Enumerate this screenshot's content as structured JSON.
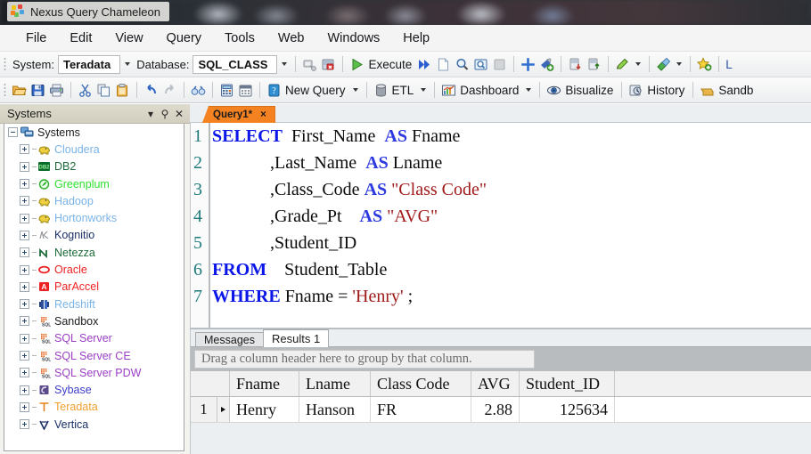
{
  "window": {
    "title": "Nexus Query Chameleon"
  },
  "menu": {
    "items": [
      {
        "label": "File"
      },
      {
        "label": "Edit"
      },
      {
        "label": "View"
      },
      {
        "label": "Query"
      },
      {
        "label": "Tools"
      },
      {
        "label": "Web"
      },
      {
        "label": "Windows"
      },
      {
        "label": "Help"
      }
    ]
  },
  "toolbar_top": {
    "system_label": "System:",
    "system_value": "Teradata",
    "database_label": "Database:",
    "database_value": "SQL_CLASS",
    "execute_label": "Execute",
    "icons": [
      "disconnect-icon",
      "stop-connection-icon",
      "execute-play-icon",
      "execute-all-icon",
      "new-document-icon",
      "find-icon",
      "find-in-window-icon",
      "stop-icon",
      "add-plus-icon",
      "add-object-icon",
      "load-data-icon",
      "export-data-icon",
      "edit-pencil-icon",
      "pencil-dropdown-caret",
      "paint-brush-icon",
      "brush-dropdown-caret",
      "favorite-star-icon",
      "truncated-l-icon"
    ]
  },
  "toolbar_bottom": {
    "new_query_label": "New Query",
    "etl_label": "ETL",
    "dashboard_label": "Dashboard",
    "bisualize_label": "Bisualize",
    "history_label": "History",
    "sandbox_label": "Sandb",
    "icons": [
      "open-folder-icon",
      "save-icon",
      "print-icon",
      "cut-icon",
      "copy-icon",
      "paste-icon",
      "undo-icon",
      "redo-icon",
      "binoculars-icon",
      "calculator-icon",
      "calendar-icon",
      "new-query-icon",
      "new-query-dropdown-caret",
      "etl-icon",
      "etl-dropdown-caret",
      "dashboard-icon",
      "dashboard-dropdown-caret",
      "bisualize-eye-icon",
      "history-icon",
      "sandbox-icon"
    ]
  },
  "sidebar": {
    "title": "Systems",
    "header_icons": [
      "chevron-down-icon",
      "pin-icon",
      "close-icon"
    ],
    "root": {
      "label": "Systems",
      "icon": "systems-root-icon",
      "color": "#1b1b1b"
    },
    "items": [
      {
        "label": "Cloudera",
        "icon": "elephant-icon",
        "color": "#7ab4e8"
      },
      {
        "label": "DB2",
        "icon": "db2-icon",
        "color": "#1d6b3a"
      },
      {
        "label": "Greenplum",
        "icon": "greenplum-icon",
        "color": "#2ee02e"
      },
      {
        "label": "Hadoop",
        "icon": "elephant-icon",
        "color": "#7ab4e8"
      },
      {
        "label": "Hortonworks",
        "icon": "elephant-icon",
        "color": "#7ab4e8"
      },
      {
        "label": "Kognitio",
        "icon": "kognitio-icon",
        "color": "#1b2f66"
      },
      {
        "label": "Netezza",
        "icon": "netezza-icon",
        "color": "#1d6b3a"
      },
      {
        "label": "Oracle",
        "icon": "oracle-icon",
        "color": "#ee2222"
      },
      {
        "label": "ParAccel",
        "icon": "paraccel-icon",
        "color": "#ee2222"
      },
      {
        "label": "Redshift",
        "icon": "redshift-icon",
        "color": "#7ab4e8"
      },
      {
        "label": "Sandbox",
        "icon": "sqlserver-icon",
        "color": "#1b1b1b"
      },
      {
        "label": "SQL Server",
        "icon": "sqlserver-icon",
        "color": "#9b3fc4"
      },
      {
        "label": "SQL Server CE",
        "icon": "sqlserver-icon",
        "color": "#9b3fc4"
      },
      {
        "label": "SQL Server PDW",
        "icon": "sqlserver-icon",
        "color": "#9b3fc4"
      },
      {
        "label": "Sybase",
        "icon": "sybase-icon",
        "color": "#3c3cc8"
      },
      {
        "label": "Teradata",
        "icon": "teradata-icon",
        "color": "#f0a030"
      },
      {
        "label": "Vertica",
        "icon": "vertica-icon",
        "color": "#1b2f66"
      }
    ]
  },
  "editor": {
    "tab": {
      "label": "Query1*",
      "close": "×"
    },
    "lines": [
      {
        "n": "1",
        "indent": 0
      },
      {
        "n": "2",
        "indent": 0
      },
      {
        "n": "3",
        "indent": 0
      },
      {
        "n": "4",
        "indent": 0
      },
      {
        "n": "5",
        "indent": 0
      },
      {
        "n": "6",
        "indent": 0
      },
      {
        "n": "7",
        "indent": 0
      }
    ],
    "code": {
      "l1_kw": "SELECT",
      "l1_col": "  First_Name",
      "l1_as": "AS",
      "l1_alias": " Fname",
      "l2_col": "             ,Last_Name",
      "l2_as": "AS",
      "l2_alias": " Lname",
      "l3_col": "             ,Class_Code",
      "l3_as": "AS",
      "l3_alias": " \"Class Code\"",
      "l4_col": "             ,Grade_Pt",
      "l4_as": "AS",
      "l4_alias": " \"AVG\"",
      "l5_col": "             ,Student_ID",
      "l6_kw": "FROM",
      "l6_rest": "    Student_Table",
      "l7_kw": "WHERE",
      "l7_mid": " Fname = ",
      "l7_str": "'Henry'",
      "l7_end": " ;"
    }
  },
  "results": {
    "tabs": [
      {
        "label": "Messages",
        "active": false
      },
      {
        "label": "Results 1",
        "active": true
      }
    ],
    "group_hint": "Drag a column header here to group by that column.",
    "columns": [
      "Fname",
      "Lname",
      "Class Code",
      "AVG",
      "Student_ID"
    ],
    "rows": [
      {
        "index": "1",
        "Fname": "Henry",
        "Lname": "Hanson",
        "Class Code": "FR",
        "AVG": "2.88",
        "Student_ID": "125634"
      }
    ]
  },
  "colors": {
    "tab_accent": "#f58220",
    "keyword": "#0b16e8",
    "string": "#a01a1a",
    "linenum": "#1d7a7a",
    "sidebar_header": "#d6d3c4"
  }
}
